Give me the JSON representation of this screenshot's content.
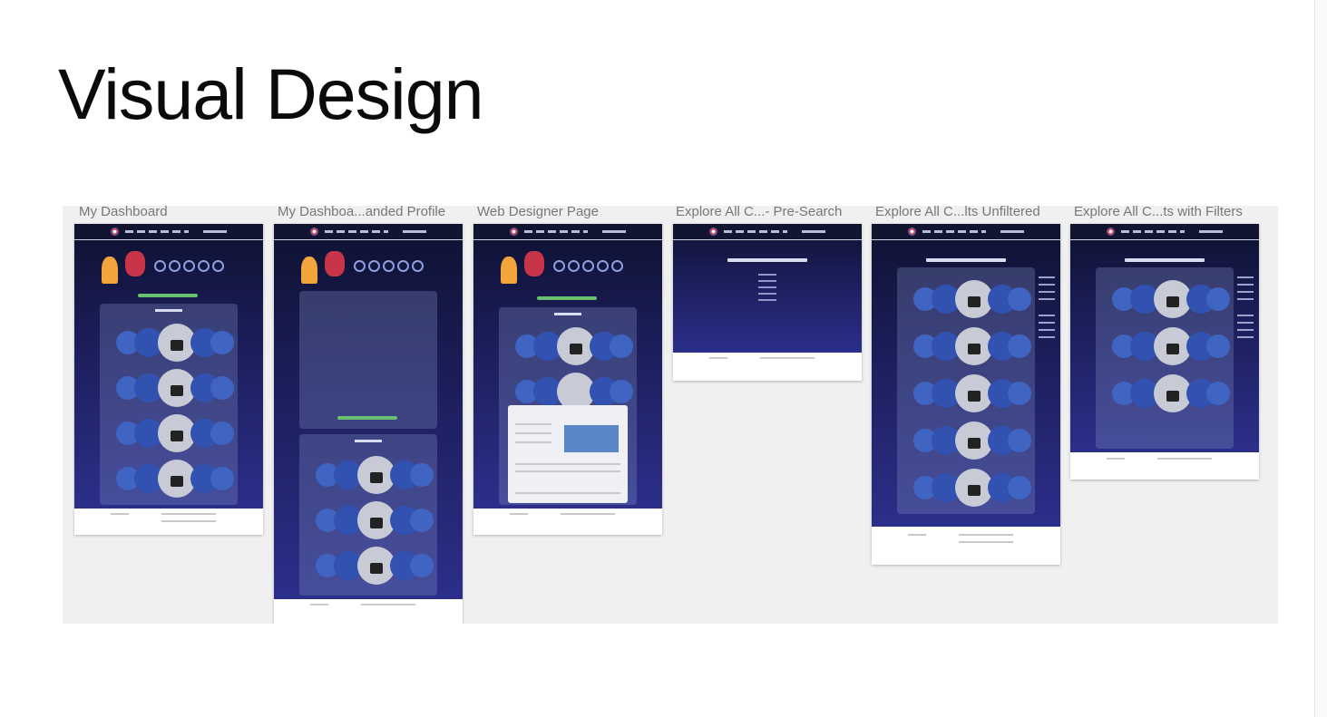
{
  "title": "Visual Design",
  "frames": [
    {
      "label": "My Dashboard"
    },
    {
      "label": "My Dashboa...anded Profile"
    },
    {
      "label": "Web Designer Page"
    },
    {
      "label": "Explore All C...- Pre-Search"
    },
    {
      "label": "Explore All C...lts Unfiltered"
    },
    {
      "label": "Explore All C...ts with Filters"
    }
  ],
  "colors": {
    "page_bg": "#ffffff",
    "canvas_bg": "#f0f0f0",
    "mock_top": "#0e1230",
    "mock_bottom": "#2c2f8a",
    "accent_green": "#68c170"
  }
}
